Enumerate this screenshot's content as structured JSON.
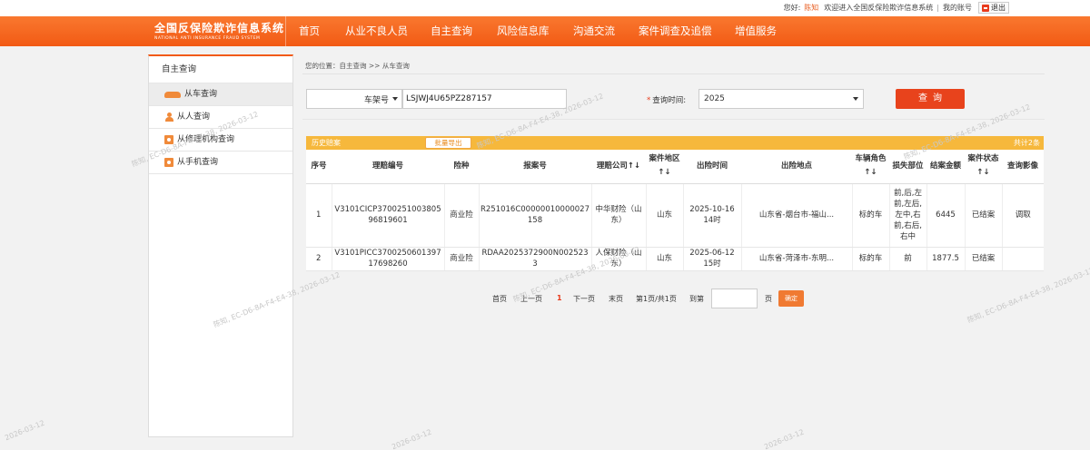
{
  "topbar": {
    "hello": "您好:",
    "user": "陈知",
    "welcome": "欢迎进入全国反保险欺诈信息系统",
    "separator": "|",
    "account": "我的账号",
    "logout": "退出"
  },
  "logo": {
    "cn": "全国反保险欺诈信息系统",
    "en": "NATIONAL ANTI INSURANCE FRAUD SYSTEM"
  },
  "nav": [
    "首页",
    "从业不良人员",
    "自主查询",
    "风险信息库",
    "沟通交流",
    "案件调查及追偿",
    "增值服务"
  ],
  "sidebar": {
    "title": "自主查询",
    "items": [
      {
        "label": "从车查询",
        "icon": "car-icon",
        "active": true
      },
      {
        "label": "从人查询",
        "icon": "person-icon"
      },
      {
        "label": "从修理机构查询",
        "icon": "repair-shop-icon"
      },
      {
        "label": "从手机查询",
        "icon": "phone-icon"
      }
    ]
  },
  "breadcrumb": "您的位置：自主查询 >> 从车查询",
  "search": {
    "type_label": "车架号",
    "vin_value": "LSJWJ4U65PZ287157",
    "time_label": "查询时间:",
    "time_value": "2025",
    "query_button": "查询"
  },
  "history": {
    "title": "历史赔案",
    "export_button": "批量导出",
    "count": "共计2条"
  },
  "table": {
    "headers": [
      "序号",
      "理赔编号",
      "险种",
      "报案号",
      "理赔公司↑↓",
      "案件地区↑↓",
      "出险时间",
      "出险地点",
      "车辆角色↑↓",
      "损失部位",
      "结案金额",
      "案件状态↑↓",
      "查询影像"
    ],
    "rows": [
      [
        "1",
        "V3101CICP370025100380596819601",
        "商业险",
        "R251016C00000010000027158",
        "中华财险（山东）",
        "山东",
        "2025-10-16 14时",
        "山东省-烟台市-福山...",
        "标的车",
        "前,后,左前,左后,左中,右前,右后,右中",
        "6445",
        "已结案",
        "调取"
      ],
      [
        "2",
        "V3101PICC370025060139717698260",
        "商业险",
        "RDAA2025372900N0025233",
        "人保财险（山东）",
        "山东",
        "2025-06-12 15时",
        "山东省-菏泽市-东明...",
        "标的车",
        "前",
        "1877.5",
        "已结案",
        ""
      ]
    ]
  },
  "pager": {
    "first": "首页",
    "prev": "上一页",
    "current": "1",
    "next": "下一页",
    "last": "末页",
    "info": "第1页/共1页",
    "goto": "到第",
    "page_unit": "页",
    "ok": "确定"
  },
  "watermarks": [
    "陈知, EC-D6-8A-F4-E4-38, 2026-03-12",
    "2026-03-12"
  ],
  "colors": {
    "nav_orange": "#f25a14",
    "query_red": "#e8431c",
    "history_yellow": "#f6b83c"
  }
}
